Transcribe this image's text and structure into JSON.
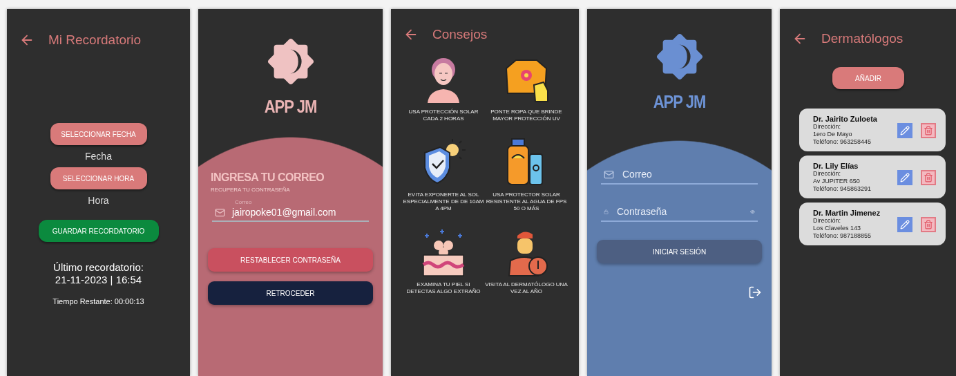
{
  "reminder": {
    "title": "Mi Recordatorio",
    "date_button": "SELECCIONAR FECHA",
    "date_label": "Fecha",
    "time_button": "SELECCIONAR HORA",
    "time_label": "Hora",
    "save_button": "GUARDAR RECORDATORIO",
    "last_title": "Último recordatorio:",
    "last_value": "21-11-2023 | 16:54",
    "remaining": "Tiempo Restante: 00:00:13"
  },
  "recovery": {
    "app_name": "APP JM",
    "heading": "INGRESA TU CORREO",
    "subheading": "RECUPERA TU CONTRASEÑA",
    "email_label": "Correo",
    "email_value": "jairopoke01@gmail.com",
    "reset_button": "RESTABLECER CONTRASEÑA",
    "back_button": "RETROCEDER"
  },
  "tips": {
    "title": "Consejos",
    "items": [
      {
        "kind": "face",
        "text": "USA PROTECCIÓN SOLAR CADA 2 HORAS"
      },
      {
        "kind": "clothing",
        "text": "PONTE ROPA QUE BRINDE MAYOR PROTECCIÓN UV"
      },
      {
        "kind": "shield",
        "text": "EVITA EXPONERTE AL SOL ESPECIALMENTE DE DE 10AM A 4PM"
      },
      {
        "kind": "sunscreen",
        "text": "USA PROTECTOR SOLAR RESISTENTE AL AGUA DE FPS 50 O MÁS"
      },
      {
        "kind": "skin",
        "text": "EXAMINA TU PIEL SI DETECTAS ALGO EXTRAÑO"
      },
      {
        "kind": "doctor",
        "text": "VISITA AL DERMATÓLOGO UNA VEZ AL AÑO"
      }
    ]
  },
  "login": {
    "app_name": "APP JM",
    "email_placeholder": "Correo",
    "password_placeholder": "Contraseña",
    "login_button": "INICIAR SESIÓN"
  },
  "dermatologists": {
    "title": "Dermatólogos",
    "add_button": "AÑADIR",
    "items": [
      {
        "name": "Dr. Jairito Zuloeta",
        "address_label": "Dirección:",
        "address": "1ero De Mayo",
        "phone": "Teléfono: 963258445"
      },
      {
        "name": "Dr. Lily Elías",
        "address_label": "Dirección:",
        "address": "Av JUPITER 650",
        "phone": "Teléfono: 945863291"
      },
      {
        "name": "Dr. Martin Jimenez",
        "address_label": "Dirección:",
        "address": "Los Claveles 143",
        "phone": "Teléfono: 987188855"
      }
    ]
  }
}
